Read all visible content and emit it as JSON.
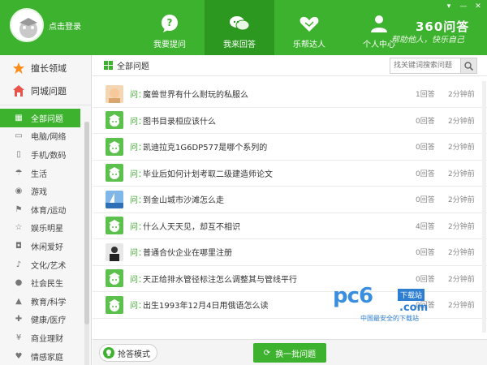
{
  "header": {
    "login_text": "点击登录",
    "brand": "360问答",
    "slogan": "帮助他人，快乐自己",
    "nav": [
      {
        "label": "我要提问",
        "icon": "question-bubble-icon"
      },
      {
        "label": "我来回答",
        "icon": "chat-bubbles-icon"
      },
      {
        "label": "乐帮达人",
        "icon": "handshake-icon"
      },
      {
        "label": "个人中心",
        "icon": "person-icon"
      }
    ],
    "active_nav": "我来回答"
  },
  "sidebar": {
    "top": [
      {
        "label": "擅长领域",
        "icon": "star-icon"
      },
      {
        "label": "同城问题",
        "icon": "house-icon"
      }
    ],
    "categories": [
      {
        "label": "全部问题",
        "icon": "grid-icon",
        "active": true
      },
      {
        "label": "电脑/网络",
        "icon": "computer-icon"
      },
      {
        "label": "手机/数码",
        "icon": "phone-icon"
      },
      {
        "label": "生活",
        "icon": "umbrella-icon"
      },
      {
        "label": "游戏",
        "icon": "gamepad-icon"
      },
      {
        "label": "体育/运动",
        "icon": "sports-icon"
      },
      {
        "label": "娱乐明星",
        "icon": "star-outline-icon"
      },
      {
        "label": "休闲爱好",
        "icon": "cup-icon"
      },
      {
        "label": "文化/艺术",
        "icon": "music-note-icon"
      },
      {
        "label": "社会民生",
        "icon": "people-icon"
      },
      {
        "label": "教育/科学",
        "icon": "graduation-icon"
      },
      {
        "label": "健康/医疗",
        "icon": "medical-icon"
      },
      {
        "label": "商业理财",
        "icon": "yen-icon"
      },
      {
        "label": "情感家庭",
        "icon": "heart-icon"
      }
    ]
  },
  "main": {
    "header_title": "全部问题",
    "search_placeholder": "找关键词搜索问题",
    "q_prefix": "问：",
    "questions": [
      {
        "text": "魔兽世界有什么耐玩的私服么",
        "answers": "1回答",
        "time": "2分钟前",
        "avatar": "photo-baby"
      },
      {
        "text": "图书目录桓应该什么",
        "answers": "0回答",
        "time": "2分钟前",
        "avatar": "default"
      },
      {
        "text": "凯迪拉克1G6DP577是哪个系列的",
        "answers": "0回答",
        "time": "2分钟前",
        "avatar": "default"
      },
      {
        "text": "毕业后如何计划考取二级建造师论文",
        "answers": "0回答",
        "time": "2分钟前",
        "avatar": "default"
      },
      {
        "text": "到金山城市沙滩怎么走",
        "answers": "0回答",
        "time": "2分钟前",
        "avatar": "photo-sail"
      },
      {
        "text": "什么人天天见，却互不相识",
        "answers": "4回答",
        "time": "2分钟前",
        "avatar": "default"
      },
      {
        "text": "普通合伙企业在哪里注册",
        "answers": "0回答",
        "time": "2分钟前",
        "avatar": "photo-person"
      },
      {
        "text": "天正给排水管径标注怎么调整其与管线平行",
        "answers": "0回答",
        "time": "2分钟前",
        "avatar": "default"
      },
      {
        "text": "出生1993年12月4日用俄语怎么读",
        "answers": "0回答",
        "time": "2分钟前",
        "avatar": "default"
      }
    ],
    "grab_mode_label": "抢答模式",
    "refresh_label": "换一批问题"
  },
  "watermark": {
    "logo": "pc6",
    "badge": "下载站",
    "com": ".com",
    "sub": "中国最安全的下载站"
  },
  "colors": {
    "brand_green": "#3db22e",
    "active_green": "#2c9820",
    "watermark_blue": "#2e7fd2"
  }
}
